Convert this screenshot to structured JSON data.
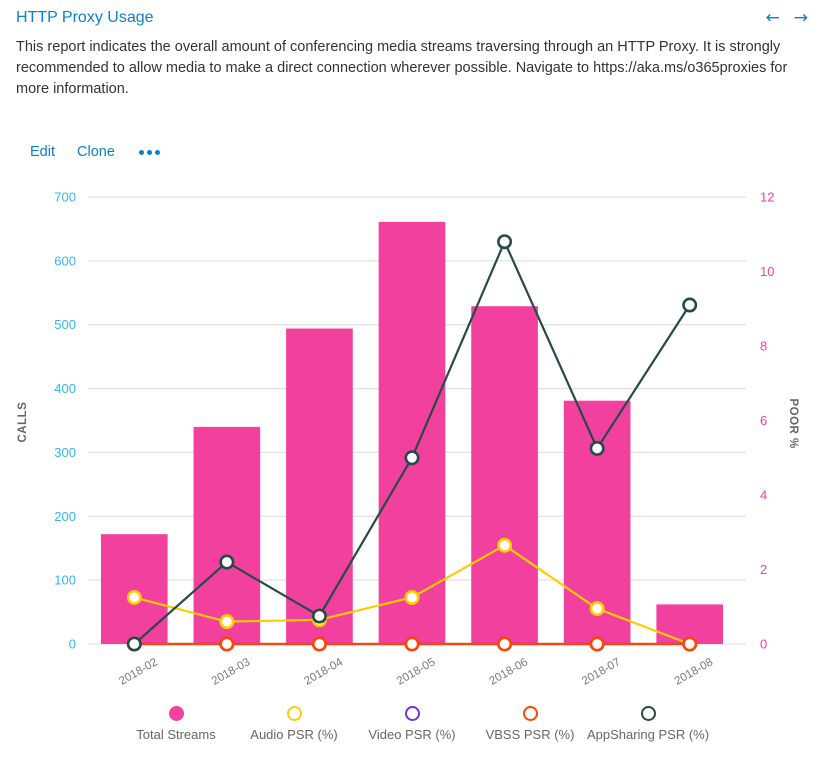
{
  "header": {
    "title": "HTTP Proxy Usage",
    "description": "This report indicates the overall amount of conferencing media streams traversing through an HTTP Proxy. It is strongly recommended to allow media to make a direct connection wherever possible. Navigate to https://aka.ms/o365proxies for more information.",
    "prev_arrow": "←",
    "next_arrow": "→"
  },
  "actions": {
    "edit_label": "Edit",
    "clone_label": "Clone",
    "more_label": "•••"
  },
  "colors": {
    "link": "#0a7fd1",
    "bar": "#f2409f",
    "left_axis": "#35b5f2",
    "right_axis": "#ef3fa0",
    "total_streams": "#f2409f",
    "audio_psr": "#ffcc00",
    "video_psr": "#7b2fd6",
    "vbss_psr": "#ff4500",
    "appsharing_psr": "#264a47"
  },
  "chart_data": {
    "type": "bar",
    "title": "",
    "xlabel": "",
    "ylabel": "CALLS",
    "y2label": "POOR %",
    "grid": true,
    "legend_position": "bottom",
    "categories": [
      "2018-02",
      "2018-03",
      "2018-04",
      "2018-05",
      "2018-06",
      "2018-07",
      "2018-08"
    ],
    "ylim": [
      0,
      700
    ],
    "yticks": [
      0,
      100,
      200,
      300,
      400,
      500,
      600,
      700
    ],
    "y2lim": [
      0,
      12
    ],
    "y2ticks": [
      0,
      2,
      4,
      6,
      8,
      10,
      12
    ],
    "series": [
      {
        "name": "Total Streams",
        "kind": "bar",
        "axis": "left",
        "color": "#f2409f",
        "values": [
          172,
          340,
          494,
          661,
          529,
          381,
          62
        ]
      },
      {
        "name": "Audio PSR (%)",
        "kind": "line",
        "axis": "right",
        "color": "#ffcc00",
        "values": [
          1.25,
          0.6,
          0.65,
          1.25,
          2.65,
          0.95,
          0
        ]
      },
      {
        "name": "Video PSR (%)",
        "kind": "line",
        "axis": "right",
        "color": "#7b2fd6",
        "values": [
          0,
          0,
          0,
          0,
          0,
          0,
          0
        ]
      },
      {
        "name": "VBSS PSR (%)",
        "kind": "line",
        "axis": "right",
        "color": "#ff4500",
        "values": [
          0,
          0,
          0,
          0,
          0,
          0,
          0
        ]
      },
      {
        "name": "AppSharing PSR (%)",
        "kind": "line",
        "axis": "right",
        "color": "#264a47",
        "values": [
          0,
          2.2,
          0.75,
          5.0,
          10.8,
          5.25,
          9.1
        ]
      }
    ]
  },
  "legend": [
    {
      "label": "Total Streams",
      "color": "#f2409f",
      "filled": true
    },
    {
      "label": "Audio PSR (%)",
      "color": "#ffcc00",
      "filled": false
    },
    {
      "label": "Video PSR (%)",
      "color": "#7b2fd6",
      "filled": false
    },
    {
      "label": "VBSS PSR (%)",
      "color": "#ff4500",
      "filled": false
    },
    {
      "label": "AppSharing PSR (%)",
      "color": "#264a47",
      "filled": false
    }
  ]
}
